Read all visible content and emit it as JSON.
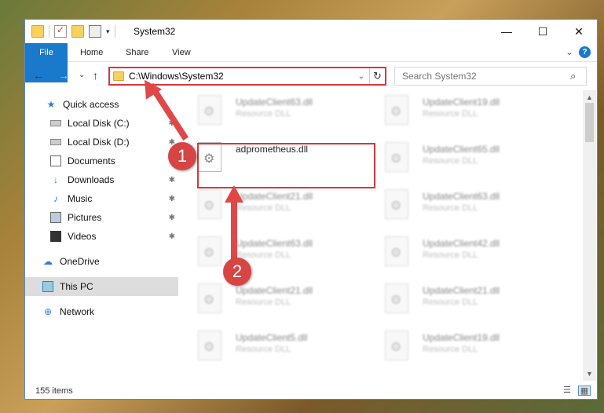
{
  "window": {
    "title": "System32",
    "controls": {
      "minimize": "—",
      "maximize": "☐",
      "close": "✕"
    }
  },
  "ribbon": {
    "tabs": [
      "File",
      "Home",
      "Share",
      "View"
    ],
    "collapse": "⌄",
    "help": "?"
  },
  "nav": {
    "back": "←",
    "forward": "→",
    "recent": "⌄",
    "up": "↑",
    "address": "C:\\Windows\\System32",
    "dropdown": "⌄",
    "refresh": "↻",
    "search_placeholder": "Search System32",
    "search_icon": "⌕"
  },
  "sidebar": {
    "items": [
      {
        "label": "Quick access",
        "icon": "star-icon",
        "glyph": "★",
        "pinned": false
      },
      {
        "label": "Local Disk (C:)",
        "icon": "drive-icon",
        "glyph": "",
        "pinned": true
      },
      {
        "label": "Local Disk (D:)",
        "icon": "drive-icon",
        "glyph": "",
        "pinned": true
      },
      {
        "label": "Documents",
        "icon": "documents-icon",
        "glyph": "",
        "pinned": true
      },
      {
        "label": "Downloads",
        "icon": "downloads-icon",
        "glyph": "↓",
        "pinned": true
      },
      {
        "label": "Music",
        "icon": "music-icon",
        "glyph": "♪",
        "pinned": true
      },
      {
        "label": "Pictures",
        "icon": "pictures-icon",
        "glyph": "",
        "pinned": true
      },
      {
        "label": "Videos",
        "icon": "videos-icon",
        "glyph": "",
        "pinned": true
      },
      {
        "label": "OneDrive",
        "icon": "onedrive-icon",
        "glyph": "☁",
        "pinned": false
      },
      {
        "label": "This PC",
        "icon": "this-pc-icon",
        "glyph": "",
        "pinned": false,
        "selected": true
      },
      {
        "label": "Network",
        "icon": "network-icon",
        "glyph": "⊕",
        "pinned": false
      }
    ],
    "pin_glyph": "✱"
  },
  "files": [
    {
      "name": "UpdateClient63.dll",
      "type": "Resource DLL",
      "blurred": true
    },
    {
      "name": "UpdateClient19.dll",
      "type": "Resource DLL",
      "blurred": true
    },
    {
      "name": "adprometheus.dll",
      "type": "",
      "blurred": false,
      "highlighted": true
    },
    {
      "name": "UpdateClient65.dll",
      "type": "Resource DLL",
      "blurred": true
    },
    {
      "name": "UpdateClient21.dll",
      "type": "Resource DLL",
      "blurred": true
    },
    {
      "name": "UpdateClient63.dll",
      "type": "Resource DLL",
      "blurred": true
    },
    {
      "name": "UpdateClient63.dll",
      "type": "Resource DLL",
      "blurred": true
    },
    {
      "name": "UpdateClient42.dll",
      "type": "Resource DLL",
      "blurred": true
    },
    {
      "name": "UpdateClient21.dll",
      "type": "Resource DLL",
      "blurred": true
    },
    {
      "name": "UpdateClient21.dll",
      "type": "Resource DLL",
      "blurred": true
    },
    {
      "name": "UpdateClient5.dll",
      "type": "Resource DLL",
      "blurred": true
    },
    {
      "name": "UpdateClient19.dll",
      "type": "Resource DLL",
      "blurred": true
    }
  ],
  "status": {
    "count": "155 items"
  },
  "callouts": {
    "step1": "1",
    "step2": "2",
    "color": "#d74444"
  },
  "accent": "#1979ca"
}
